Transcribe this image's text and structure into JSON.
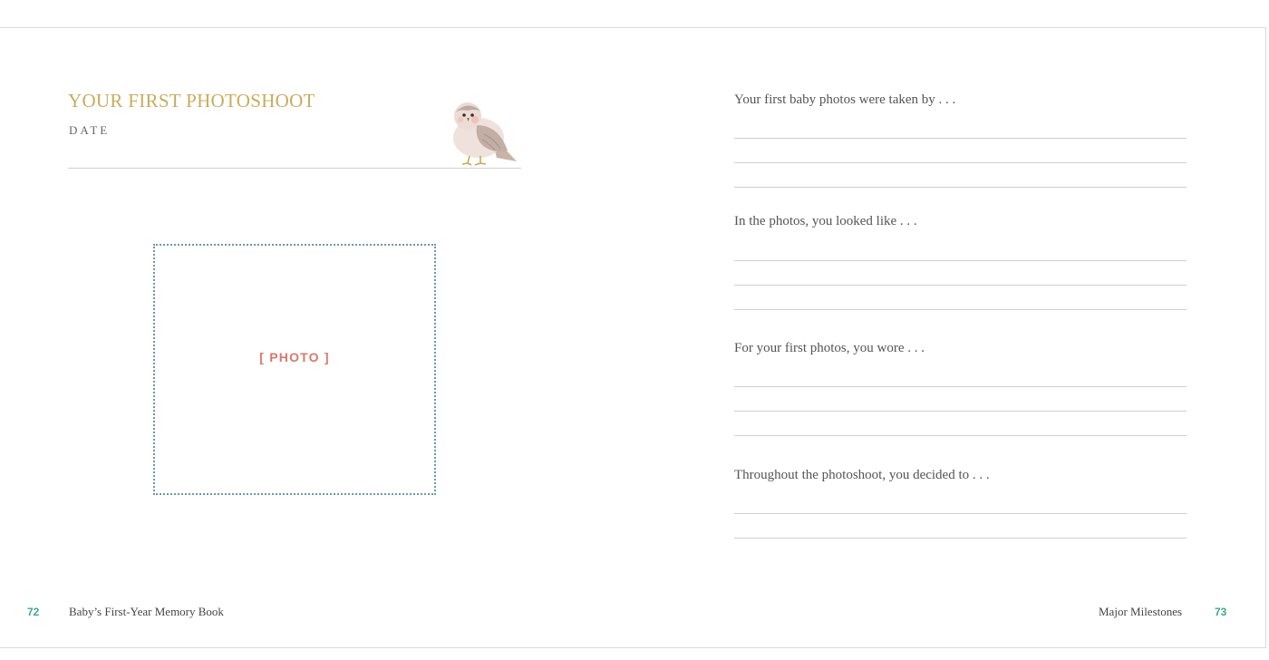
{
  "left_page": {
    "title": "YOUR FIRST PHOTOSHOOT",
    "date_label": "DATE",
    "illustration": "bird-illustration",
    "photo_placeholder": "[ PHOTO ]",
    "page_number": "72",
    "footer_title": "Baby’s First-Year Memory Book"
  },
  "right_page": {
    "prompts": [
      {
        "text": "Your first baby photos were taken by . . ."
      },
      {
        "text": "In the photos, you looked like . . ."
      },
      {
        "text": "For your first photos, you wore . . ."
      },
      {
        "text": "Throughout the photoshoot, you decided to . . ."
      }
    ],
    "footer_title": "Major Milestones",
    "page_number": "73"
  },
  "colors": {
    "title_gold": "#c9ac5a",
    "photo_label": "#d9786a",
    "frame_dots": "#6a9aa6",
    "page_number": "#3ea88f"
  }
}
